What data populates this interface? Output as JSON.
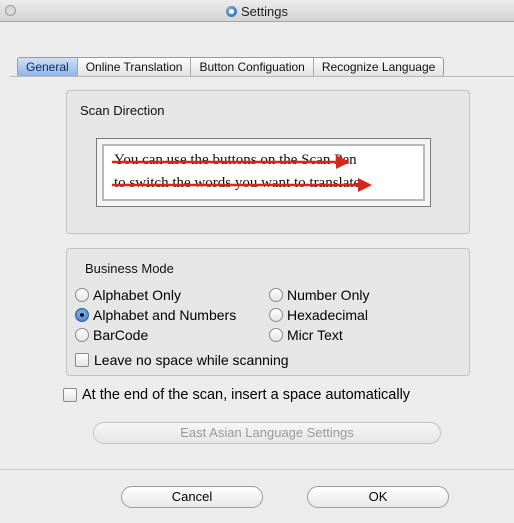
{
  "window": {
    "title": "Settings"
  },
  "tabs": [
    {
      "label": "General",
      "active": true
    },
    {
      "label": "Online Translation",
      "active": false
    },
    {
      "label": "Button Configuation",
      "active": false
    },
    {
      "label": "Recognize Language",
      "active": false
    }
  ],
  "scan_direction": {
    "label": "Scan Direction",
    "line1": "You can use the buttons on the Scan Pen",
    "line2": "to switch the words you want to translate"
  },
  "business_mode": {
    "label": "Business Mode",
    "options": [
      {
        "label": "Alphabet Only",
        "selected": false
      },
      {
        "label": "Number Only",
        "selected": false
      },
      {
        "label": "Alphabet and Numbers",
        "selected": true
      },
      {
        "label": "Hexadecimal",
        "selected": false
      },
      {
        "label": "BarCode",
        "selected": false
      },
      {
        "label": "Micr Text",
        "selected": false
      }
    ],
    "leave_no_space": {
      "label": "Leave no space while scanning",
      "checked": false
    }
  },
  "insert_space": {
    "label": "At the end of the scan, insert a space automatically",
    "checked": false
  },
  "east_asian_button": "East Asian Language Settings",
  "buttons": {
    "cancel": "Cancel",
    "ok": "OK"
  },
  "colors": {
    "tab_active": "#8fb4e6",
    "arrow": "#d8261c"
  }
}
